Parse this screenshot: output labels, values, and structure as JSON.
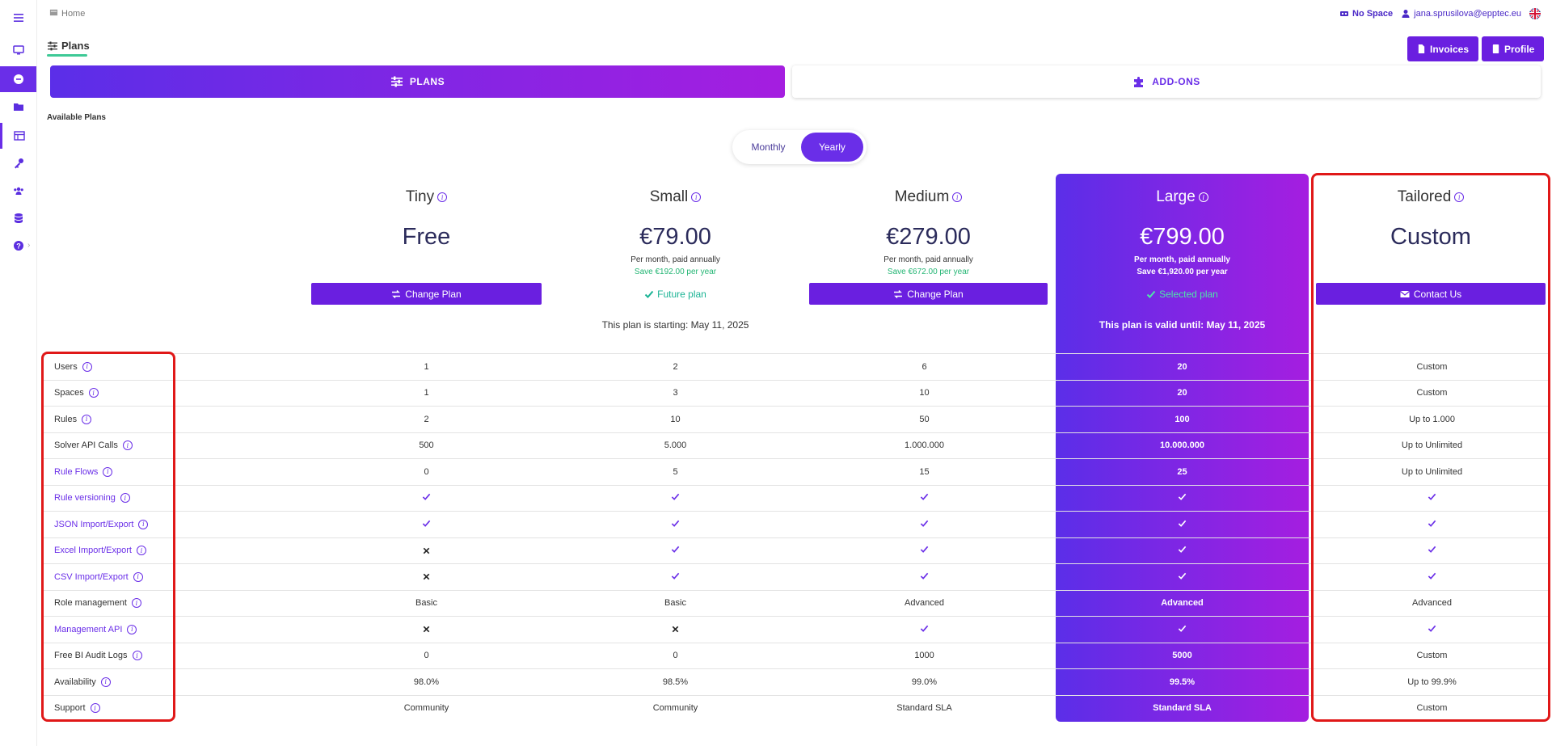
{
  "breadcrumb": {
    "home": "Home"
  },
  "topbar": {
    "space": "No Space",
    "user": "jana.sprusilova@epptec.eu"
  },
  "page": {
    "title": "Plans",
    "invoices": "Invoices",
    "profile": "Profile"
  },
  "tabs": {
    "plans": "PLANS",
    "addons": "ADD-ONS"
  },
  "section": {
    "label": "Available Plans"
  },
  "billing_toggle": {
    "monthly": "Monthly",
    "yearly": "Yearly",
    "selected": "Yearly"
  },
  "plans": {
    "tiny": {
      "name": "Tiny",
      "price": "Free",
      "sub": "",
      "save": "",
      "action": "Change Plan",
      "note": ""
    },
    "small": {
      "name": "Small",
      "price": "€79.00",
      "sub": "Per month, paid annually",
      "save": "Save €192.00 per year",
      "status": "Future plan",
      "note": "This plan is starting: May 11, 2025"
    },
    "medium": {
      "name": "Medium",
      "price": "€279.00",
      "sub": "Per month, paid annually",
      "save": "Save €672.00 per year",
      "action": "Change Plan",
      "note": ""
    },
    "large": {
      "name": "Large",
      "price": "€799.00",
      "sub": "Per month, paid annually",
      "save": "Save €1,920.00 per year",
      "status": "Selected plan",
      "note": "This plan is valid until: May 11, 2025"
    },
    "tailored": {
      "name": "Tailored",
      "price": "Custom",
      "sub": "",
      "save": "",
      "action": "Contact Us",
      "note": ""
    }
  },
  "features": [
    {
      "name": "Users",
      "link": false,
      "tiny": "1",
      "small": "2",
      "medium": "6",
      "large": "20",
      "tailored": "Custom"
    },
    {
      "name": "Spaces",
      "link": false,
      "tiny": "1",
      "small": "3",
      "medium": "10",
      "large": "20",
      "tailored": "Custom"
    },
    {
      "name": "Rules",
      "link": false,
      "tiny": "2",
      "small": "10",
      "medium": "50",
      "large": "100",
      "tailored": "Up to 1.000"
    },
    {
      "name": "Solver API Calls",
      "link": false,
      "tiny": "500",
      "small": "5.000",
      "medium": "1.000.000",
      "large": "10.000.000",
      "tailored": "Up to Unlimited"
    },
    {
      "name": "Rule Flows",
      "link": true,
      "tiny": "0",
      "small": "5",
      "medium": "15",
      "large": "25",
      "tailored": "Up to Unlimited"
    },
    {
      "name": "Rule versioning",
      "link": true,
      "tiny": "check",
      "small": "check",
      "medium": "check",
      "large": "check",
      "tailored": "check"
    },
    {
      "name": "JSON Import/Export",
      "link": true,
      "tiny": "check",
      "small": "check",
      "medium": "check",
      "large": "check",
      "tailored": "check"
    },
    {
      "name": "Excel Import/Export",
      "link": true,
      "tiny": "cross",
      "small": "check",
      "medium": "check",
      "large": "check",
      "tailored": "check"
    },
    {
      "name": "CSV Import/Export",
      "link": true,
      "tiny": "cross",
      "small": "check",
      "medium": "check",
      "large": "check",
      "tailored": "check"
    },
    {
      "name": "Role management",
      "link": false,
      "tiny": "Basic",
      "small": "Basic",
      "medium": "Advanced",
      "large": "Advanced",
      "tailored": "Advanced"
    },
    {
      "name": "Management API",
      "link": true,
      "tiny": "cross",
      "small": "cross",
      "medium": "check",
      "large": "check",
      "tailored": "check"
    },
    {
      "name": "Free BI Audit Logs",
      "link": false,
      "tiny": "0",
      "small": "0",
      "medium": "1000",
      "large": "5000",
      "tailored": "Custom"
    },
    {
      "name": "Availability",
      "link": false,
      "tiny": "98.0%",
      "small": "98.5%",
      "medium": "99.0%",
      "large": "99.5%",
      "tailored": "Up to 99.9%"
    },
    {
      "name": "Support",
      "link": false,
      "tiny": "Community",
      "small": "Community",
      "medium": "Standard SLA",
      "large": "Standard SLA",
      "tailored": "Custom"
    }
  ],
  "colors": {
    "accent": "#6a2ee8",
    "gradient_start": "#5b2ee8",
    "gradient_end": "#a51ee0",
    "success": "#22b573",
    "highlight": "#e01818"
  }
}
